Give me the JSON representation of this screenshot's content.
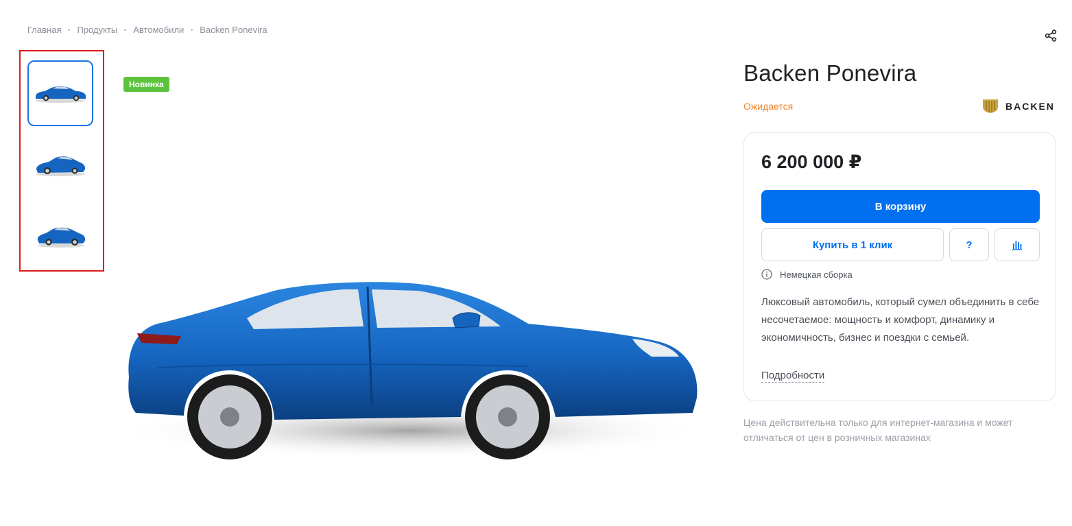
{
  "breadcrumb": {
    "items": [
      "Главная",
      "Продукты",
      "Автомобили",
      "Backen Ponevira"
    ]
  },
  "icons": {
    "share": "share-icon",
    "info": "info-icon",
    "compare": "bar-chart-icon",
    "brand_logo": "backen-logo"
  },
  "gallery": {
    "thumbnails": [
      "car-thumb-side",
      "car-thumb-front-three-quarter",
      "car-thumb-rear-three-quarter"
    ],
    "active_index": 0,
    "badge": "Новинка"
  },
  "product": {
    "title": "Backen Ponevira",
    "status": "Ожидается",
    "brand": "BACKEN",
    "price": "6 200 000 ₽",
    "buttons": {
      "cart": "В корзину",
      "one_click": "Купить в 1 клик",
      "question": "?"
    },
    "assembly": "Немецкая сборка",
    "description": "Люксовый автомобиль, который сумел объединить в себе несочетаемое: мощность и комфорт, динамику и экономичность, бизнес и поездки с семьей.",
    "more_link": "Подробности",
    "price_note": "Цена действительна только для интернет-магазина и может отличаться от цен в розничных магазинах"
  },
  "colors": {
    "accent": "#0070f0",
    "status": "#f2862a",
    "badge": "#5cc43c",
    "active_thumb": "#1a73e8",
    "highlight_frame": "#e01b1b",
    "car_body": "#1565c0"
  }
}
